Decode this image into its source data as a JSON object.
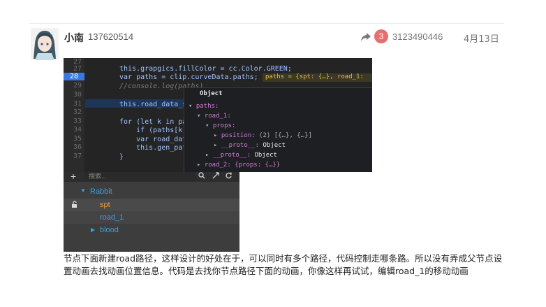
{
  "post": {
    "username": "小南",
    "user_id": "137620514",
    "reply_count": "3",
    "reply_to": "3123490446",
    "date": "4月13日",
    "text": "节点下面新建road路径，这样设计的好处在于，可以同时有多个路径，代码控制走哪条路。所以没有弄成父节点设置动画去找动画位置信息。代码是去找你节点路径下面的动画，你像这样再试试，编辑road_1的移动动画"
  },
  "icons": {
    "share": "share-arrow-icon",
    "avatar": "anime-girl-avatar"
  },
  "code_editor": {
    "lines": [
      {
        "n": "27",
        "code": "this.grapgics.fillColor = cc.Color.GREEN;"
      },
      {
        "n": "28",
        "code": "var paths = clip.curveData.paths;"
      },
      {
        "n": "29",
        "code": "//console.log(paths)"
      },
      {
        "n": "30",
        "code": ""
      },
      {
        "n": "31",
        "code": "this.road_data_s"
      },
      {
        "n": "32",
        "code": ""
      },
      {
        "n": "33",
        "code": "for (let k in pa"
      },
      {
        "n": "34",
        "code": "    if (paths[k]"
      },
      {
        "n": "35",
        "code": "    var road_dat"
      },
      {
        "n": "36",
        "code": "    this.gen_pat"
      },
      {
        "n": "37",
        "code": "}"
      }
    ],
    "inline_tip": "paths = {spt: {…}, road_1:",
    "popup": {
      "title": "Object",
      "paths": "paths:",
      "road_1": "road_1:",
      "props": "props:",
      "position_key": "position:",
      "position_val": "(2) [{…}, {…}]",
      "proto1_key": "__proto__:",
      "proto1_val": "Object",
      "proto2_key": "__proto__:",
      "proto2_val": "Object",
      "road_2": "road_2: {props: {…}}"
    }
  },
  "node_tree": {
    "search_placeholder": "搜索...",
    "items": [
      "Rabbit",
      "spt",
      "road_1",
      "blood"
    ]
  },
  "colors": {
    "badge": "#e86f6f",
    "tree_blue": "#3b9fe0",
    "tree_orange": "#e8a33a"
  }
}
